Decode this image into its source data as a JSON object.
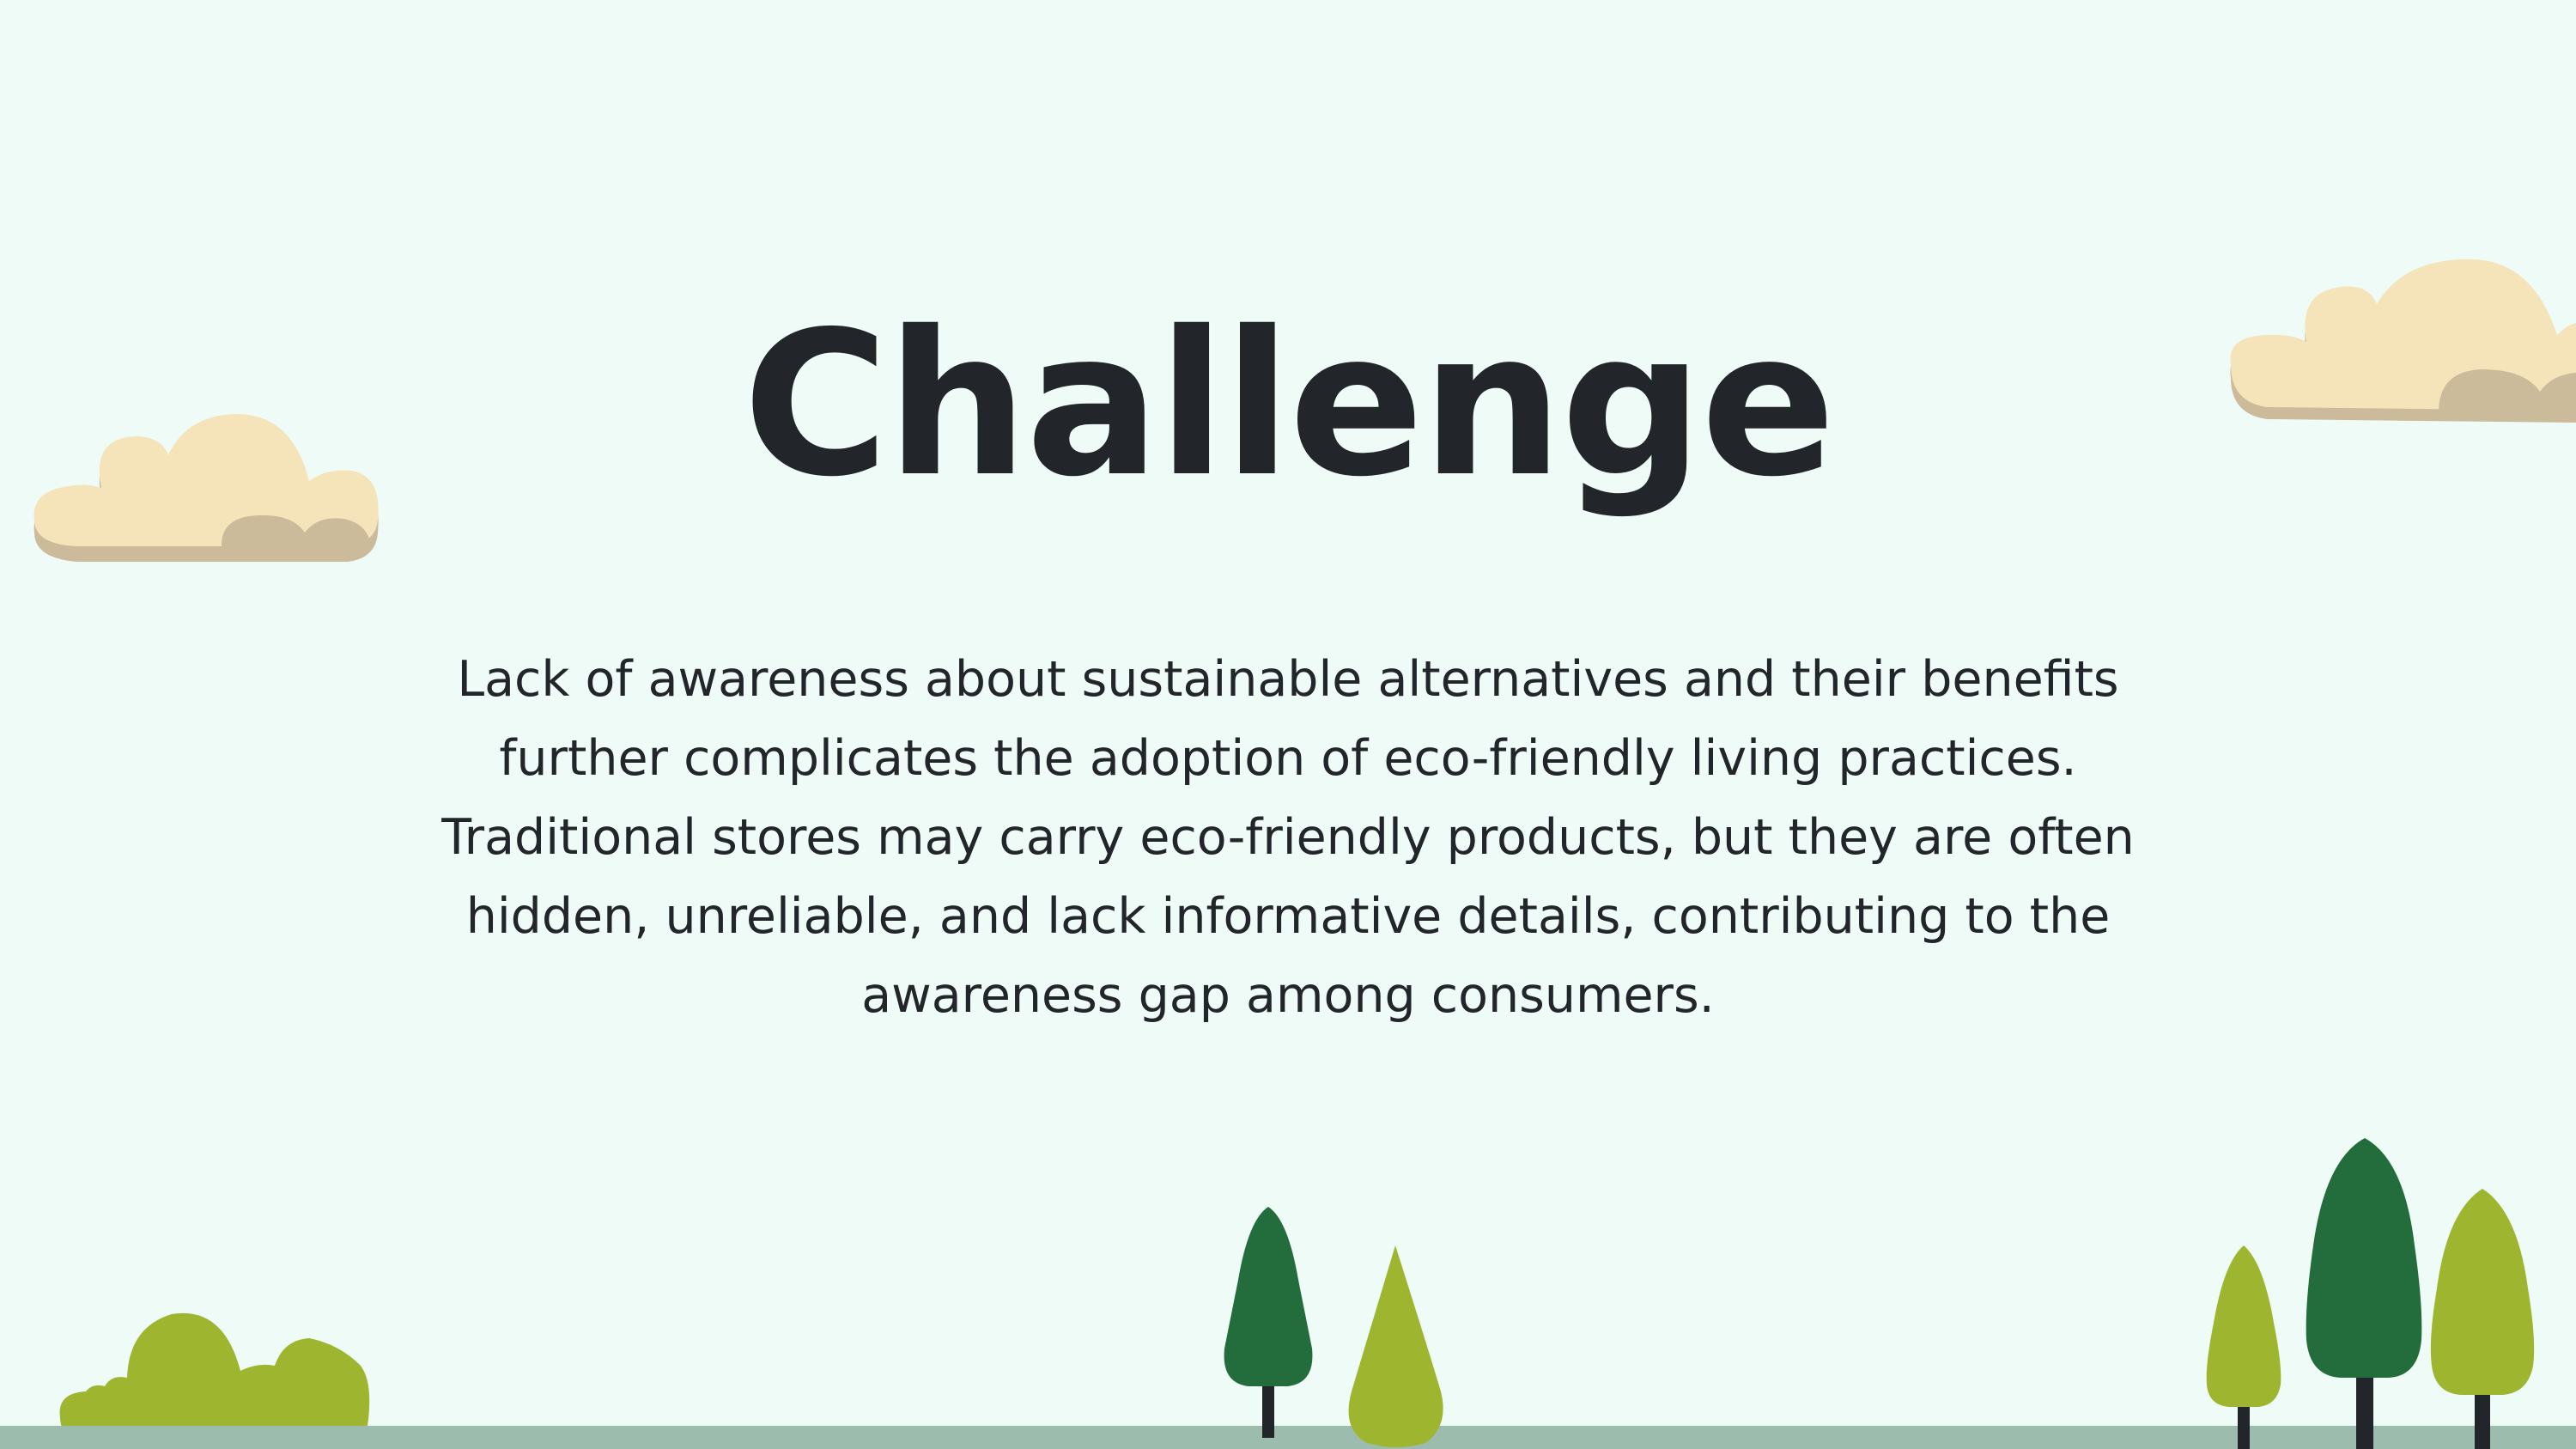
{
  "slide": {
    "title": "Challenge",
    "body": "Lack of awareness about sustainable alternatives and their benefits further complicates the adoption of eco-friendly living practices. Traditional stores may carry eco-friendly products, but they are often hidden, unreliable, and lack informative details, contributing to the awareness gap among consumers."
  },
  "colors": {
    "background": "#effbf7",
    "text": "#22252a",
    "cloud": "#f5e4b9",
    "cloud_shadow": "#cbbb9a",
    "ground": "#9cbdad",
    "tree_dark": "#236c3b",
    "tree_light": "#9db52f",
    "trunk": "#22252a"
  },
  "decorations": [
    "cloud-left",
    "cloud-right",
    "bush",
    "tree-dark",
    "tree-light",
    "ground-strip"
  ]
}
